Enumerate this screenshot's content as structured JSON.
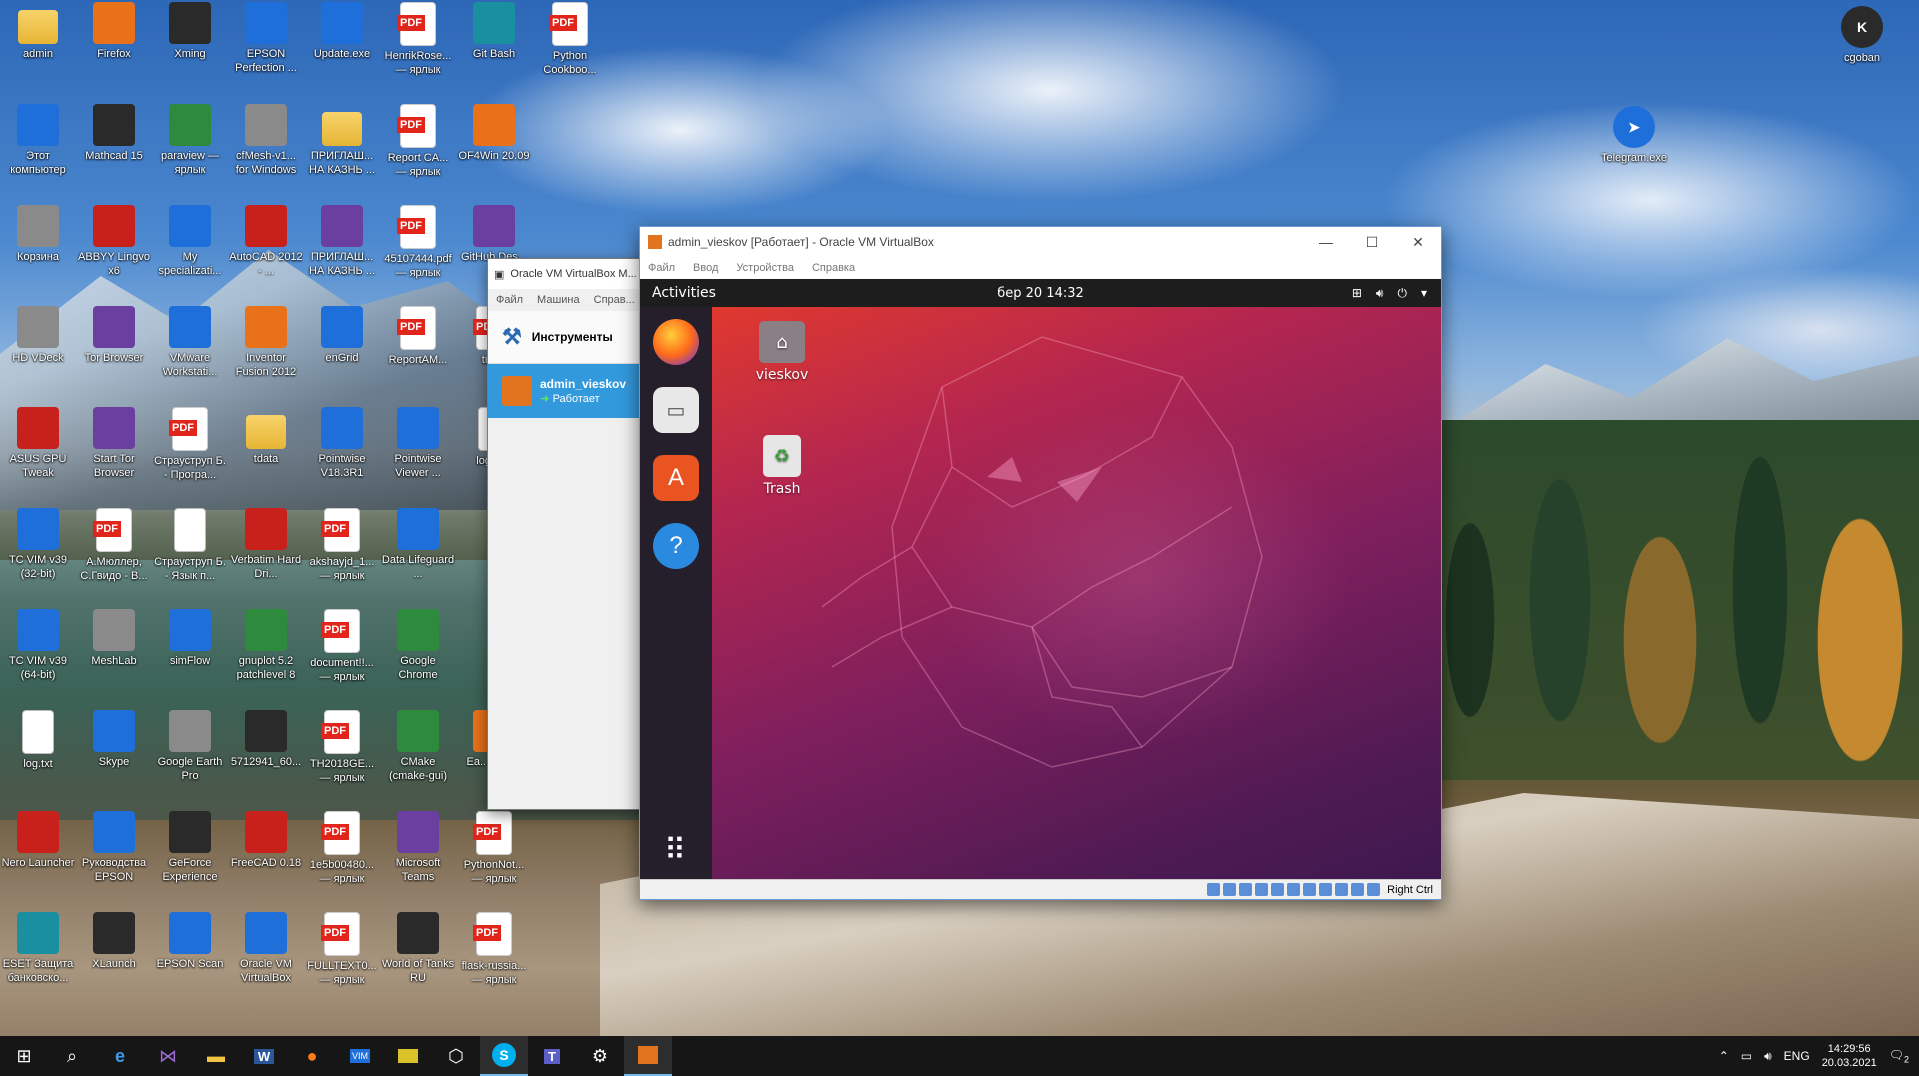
{
  "desktop_icons": [
    {
      "label": "admin",
      "col": 0,
      "row": 0,
      "kind": "folder"
    },
    {
      "label": "Firefox",
      "col": 1,
      "row": 0,
      "kind": "orange"
    },
    {
      "label": "Xming",
      "col": 2,
      "row": 0,
      "kind": "dark"
    },
    {
      "label": "EPSON Perfection ...",
      "col": 3,
      "row": 0,
      "kind": "blue"
    },
    {
      "label": "Update.exe",
      "col": 4,
      "row": 0,
      "kind": "blue"
    },
    {
      "label": "HenrikRose... — ярлык",
      "col": 5,
      "row": 0,
      "kind": "pdf"
    },
    {
      "label": "Git Bash",
      "col": 6,
      "row": 0,
      "kind": "teal"
    },
    {
      "label": "Python Cookboo...",
      "col": 7,
      "row": 0,
      "kind": "pdf"
    },
    {
      "label": "Этот компьютер",
      "col": 0,
      "row": 1,
      "kind": "blue"
    },
    {
      "label": "Mathcad 15",
      "col": 1,
      "row": 1,
      "kind": "dark"
    },
    {
      "label": "paraview — ярлык",
      "col": 2,
      "row": 1,
      "kind": "green"
    },
    {
      "label": "cfMesh-v1... for Windows",
      "col": 3,
      "row": 1,
      "kind": "grey"
    },
    {
      "label": "ПРИГЛАШ... НА КАЗНЬ ...",
      "col": 4,
      "row": 1,
      "kind": "folder"
    },
    {
      "label": "Report CA... — ярлык",
      "col": 5,
      "row": 1,
      "kind": "pdf"
    },
    {
      "label": "OF4Win 20.09",
      "col": 6,
      "row": 1,
      "kind": "orange"
    },
    {
      "label": "Корзина",
      "col": 0,
      "row": 2,
      "kind": "grey"
    },
    {
      "label": "ABBYY Lingvo x6",
      "col": 1,
      "row": 2,
      "kind": "red"
    },
    {
      "label": "My specializati...",
      "col": 2,
      "row": 2,
      "kind": "blue"
    },
    {
      "label": "AutoCAD 2012 - ...",
      "col": 3,
      "row": 2,
      "kind": "red"
    },
    {
      "label": "ПРИГЛАШ... НА КАЗНЬ ...",
      "col": 4,
      "row": 2,
      "kind": "purple"
    },
    {
      "label": "45107444.pdf — ярлык",
      "col": 5,
      "row": 2,
      "kind": "pdf"
    },
    {
      "label": "GitHub Des...",
      "col": 6,
      "row": 2,
      "kind": "purple"
    },
    {
      "label": "HD VDeck",
      "col": 0,
      "row": 3,
      "kind": "grey"
    },
    {
      "label": "Tor Browser",
      "col": 1,
      "row": 3,
      "kind": "purple"
    },
    {
      "label": "VMware Workstati...",
      "col": 2,
      "row": 3,
      "kind": "blue"
    },
    {
      "label": "Inventor Fusion 2012",
      "col": 3,
      "row": 3,
      "kind": "orange"
    },
    {
      "label": "enGrid",
      "col": 4,
      "row": 3,
      "kind": "blue"
    },
    {
      "label": "ReportAM...",
      "col": 5,
      "row": 3,
      "kind": "pdf"
    },
    {
      "label": "tup...",
      "col": 6,
      "row": 3,
      "kind": "pdf"
    },
    {
      "label": "ASUS GPU Tweak",
      "col": 0,
      "row": 4,
      "kind": "red"
    },
    {
      "label": "Start Tor Browser",
      "col": 1,
      "row": 4,
      "kind": "purple"
    },
    {
      "label": "Страуструп Б. - Програ...",
      "col": 2,
      "row": 4,
      "kind": "pdf"
    },
    {
      "label": "tdata",
      "col": 3,
      "row": 4,
      "kind": "folder"
    },
    {
      "label": "Pointwise V18.3R1",
      "col": 4,
      "row": 4,
      "kind": "blue"
    },
    {
      "label": "Pointwise Viewer ...",
      "col": 5,
      "row": 4,
      "kind": "blue"
    },
    {
      "label": "log_s...",
      "col": 6,
      "row": 4,
      "kind": "doc"
    },
    {
      "label": "TC VIM v39 (32-bit)",
      "col": 0,
      "row": 5,
      "kind": "blue"
    },
    {
      "label": "А.Мюллер, С.Гвидо - В...",
      "col": 1,
      "row": 5,
      "kind": "pdf"
    },
    {
      "label": "Страуструп Б. - Язык п...",
      "col": 2,
      "row": 5,
      "kind": "doc"
    },
    {
      "label": "Verbatim Hard Dri...",
      "col": 3,
      "row": 5,
      "kind": "red"
    },
    {
      "label": "akshayjd_1... — ярлык",
      "col": 4,
      "row": 5,
      "kind": "pdf"
    },
    {
      "label": "Data Lifeguard ...",
      "col": 5,
      "row": 5,
      "kind": "blue"
    },
    {
      "label": "TC VIM v39 (64-bit)",
      "col": 0,
      "row": 6,
      "kind": "blue"
    },
    {
      "label": "MeshLab",
      "col": 1,
      "row": 6,
      "kind": "grey"
    },
    {
      "label": "simFlow",
      "col": 2,
      "row": 6,
      "kind": "blue"
    },
    {
      "label": "gnuplot 5.2 patchlevel 8",
      "col": 3,
      "row": 6,
      "kind": "green"
    },
    {
      "label": "document!!... — ярлык",
      "col": 4,
      "row": 6,
      "kind": "pdf"
    },
    {
      "label": "Google Chrome",
      "col": 5,
      "row": 6,
      "kind": "green"
    },
    {
      "label": "log.txt",
      "col": 0,
      "row": 7,
      "kind": "doc"
    },
    {
      "label": "Skype",
      "col": 1,
      "row": 7,
      "kind": "blue"
    },
    {
      "label": "Google Earth Pro",
      "col": 2,
      "row": 7,
      "kind": "grey"
    },
    {
      "label": "5712941_60...",
      "col": 3,
      "row": 7,
      "kind": "dark"
    },
    {
      "label": "TH2018GE... — ярлык",
      "col": 4,
      "row": 7,
      "kind": "pdf"
    },
    {
      "label": "CMake (cmake-gui)",
      "col": 5,
      "row": 7,
      "kind": "green"
    },
    {
      "label": "Ea... Part...",
      "col": 6,
      "row": 7,
      "kind": "orange"
    },
    {
      "label": "Nero Launcher",
      "col": 0,
      "row": 8,
      "kind": "red"
    },
    {
      "label": "Руководства EPSON",
      "col": 1,
      "row": 8,
      "kind": "blue"
    },
    {
      "label": "GeForce Experience",
      "col": 2,
      "row": 8,
      "kind": "dark"
    },
    {
      "label": "FreeCAD 0.18",
      "col": 3,
      "row": 8,
      "kind": "red"
    },
    {
      "label": "1e5b00480... — ярлык",
      "col": 4,
      "row": 8,
      "kind": "pdf"
    },
    {
      "label": "Microsoft Teams",
      "col": 5,
      "row": 8,
      "kind": "purple"
    },
    {
      "label": "PythonNot... — ярлык",
      "col": 6,
      "row": 8,
      "kind": "pdf"
    },
    {
      "label": "ESET Защита банковско...",
      "col": 0,
      "row": 9,
      "kind": "teal"
    },
    {
      "label": "XLaunch",
      "col": 1,
      "row": 9,
      "kind": "dark"
    },
    {
      "label": "EPSON Scan",
      "col": 2,
      "row": 9,
      "kind": "blue"
    },
    {
      "label": "Oracle VM VirtualBox",
      "col": 3,
      "row": 9,
      "kind": "blue"
    },
    {
      "label": "FULLTEXT0... — ярлык",
      "col": 4,
      "row": 9,
      "kind": "pdf"
    },
    {
      "label": "World of Tanks RU",
      "col": 5,
      "row": 9,
      "kind": "dark"
    },
    {
      "label": "flask-russia... — ярлык",
      "col": 6,
      "row": 9,
      "kind": "pdf"
    }
  ],
  "right_icons": [
    {
      "label": "cgoban",
      "kind": "dark"
    },
    {
      "label": "Telegram.exe",
      "kind": "blue"
    }
  ],
  "vbox_manager": {
    "title": "Oracle VM VirtualBox M...",
    "menu": [
      "Файл",
      "Машина",
      "Справ..."
    ],
    "tools_label": "Инструменты",
    "vm_name": "admin_vieskov",
    "vm_state": "Работает"
  },
  "vm_window": {
    "title": "admin_vieskov [Работает] - Oracle VM VirtualBox",
    "menu": [
      "Файл",
      "Ввод",
      "Устройства",
      "Справка"
    ],
    "controls": [
      "—",
      "☐",
      "✕"
    ],
    "host_key": "Right Ctrl"
  },
  "ubuntu": {
    "activities": "Activities",
    "clock": "бер 20  14:32",
    "desktop_icons": [
      "vieskov",
      "Trash"
    ],
    "dock": [
      "firefox-icon",
      "files-icon",
      "software-icon",
      "help-icon"
    ]
  },
  "taskbar": {
    "lang": "ENG",
    "time": "14:29:56",
    "date": "20.03.2021",
    "notifications": "2"
  }
}
